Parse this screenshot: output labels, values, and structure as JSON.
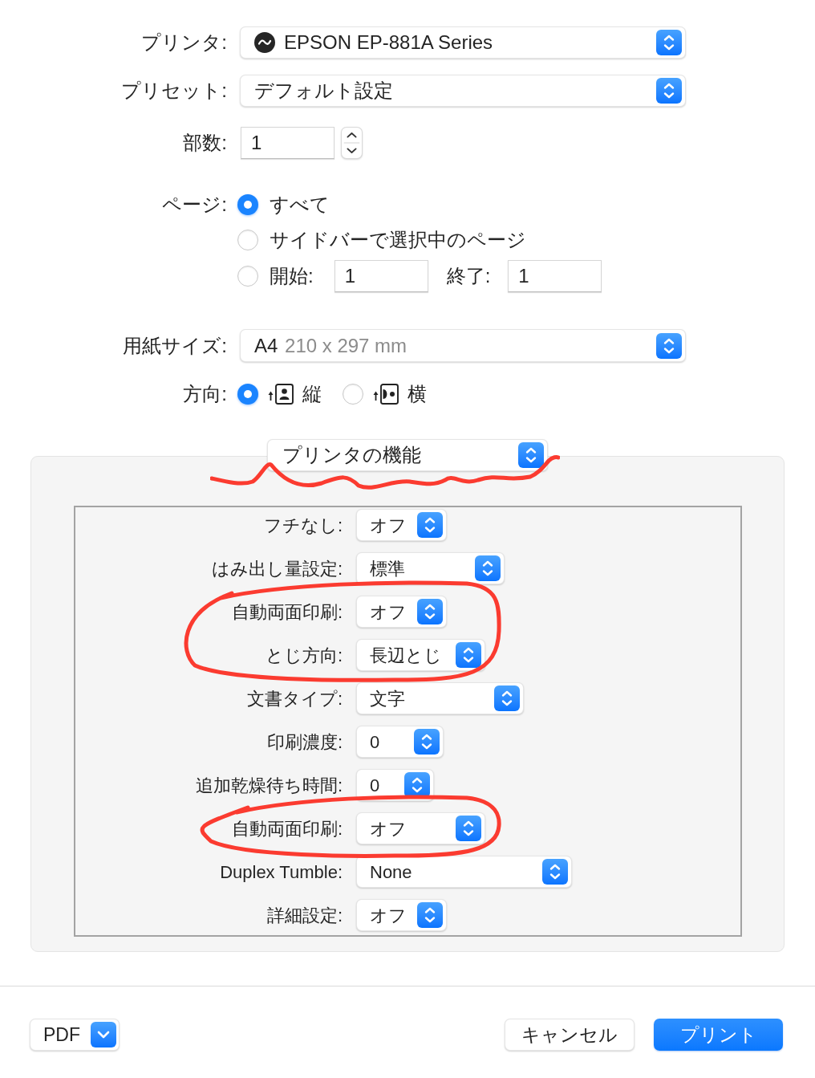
{
  "printer": {
    "label": "プリンタ:",
    "value": "EPSON EP-881A Series"
  },
  "preset": {
    "label": "プリセット:",
    "value": "デフォルト設定"
  },
  "copies": {
    "label": "部数:",
    "value": "1"
  },
  "pages": {
    "label": "ページ:",
    "options": [
      {
        "kind": "plain",
        "label": "すべて",
        "selected": true
      },
      {
        "kind": "plain",
        "label": "サイドバーで選択中のページ",
        "selected": false
      },
      {
        "kind": "range",
        "label": "開始:",
        "from": "1",
        "to_label": "終了:",
        "to": "1",
        "selected": false
      }
    ]
  },
  "paper_size": {
    "label": "用紙サイズ:",
    "value": "A4",
    "detail": "210 x 297 mm"
  },
  "orientation": {
    "label": "方向:",
    "options": [
      {
        "kind": "portrait",
        "label": "縦",
        "selected": true
      },
      {
        "kind": "landscape",
        "label": "横",
        "selected": false
      }
    ]
  },
  "section_menu": {
    "value": "プリンタの機能",
    "underlined": true
  },
  "features": [
    {
      "label": "フチなし:",
      "value": "オフ",
      "circled": false
    },
    {
      "label": "はみ出し量設定:",
      "value": "標準",
      "circled": false
    },
    {
      "label": "自動両面印刷:",
      "value": "オフ",
      "circled": true
    },
    {
      "label": "とじ方向:",
      "value": "長辺とじ",
      "circled": true
    },
    {
      "label": "文書タイプ:",
      "value": "文字",
      "circled": false
    },
    {
      "label": "印刷濃度:",
      "value": "0",
      "circled": false
    },
    {
      "label": "追加乾燥待ち時間:",
      "value": "0",
      "circled": false
    },
    {
      "label": "自動両面印刷:",
      "value": "オフ",
      "circled": true
    },
    {
      "label": "Duplex Tumble:",
      "value": "None",
      "circled": false
    },
    {
      "label": "詳細設定:",
      "value": "オフ",
      "circled": false
    }
  ],
  "footer": {
    "pdf": "PDF",
    "buttons": [
      {
        "label": "キャンセル",
        "kind": "normal"
      },
      {
        "label": "プリント",
        "kind": "default"
      }
    ]
  }
}
